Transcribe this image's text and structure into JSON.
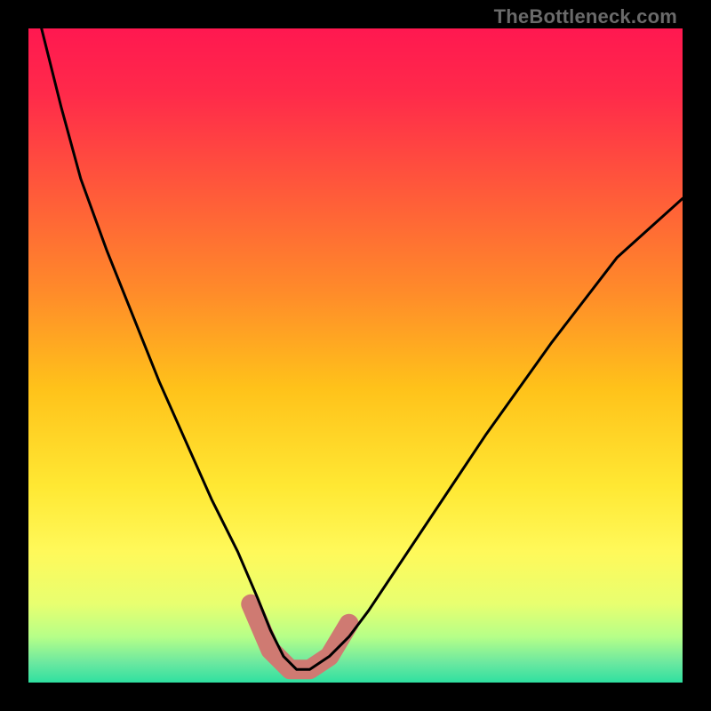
{
  "watermark": {
    "text": "TheBottleneck.com"
  },
  "colors": {
    "frame": "#000000",
    "curve_stroke": "#000000",
    "overlay_stroke": "#cf7a72",
    "gradient_stops": [
      {
        "offset": 0.0,
        "color": "#ff1850"
      },
      {
        "offset": 0.1,
        "color": "#ff2a4a"
      },
      {
        "offset": 0.25,
        "color": "#ff5a3a"
      },
      {
        "offset": 0.4,
        "color": "#ff8a2a"
      },
      {
        "offset": 0.55,
        "color": "#ffc21a"
      },
      {
        "offset": 0.7,
        "color": "#ffe833"
      },
      {
        "offset": 0.8,
        "color": "#fff95a"
      },
      {
        "offset": 0.88,
        "color": "#e8ff70"
      },
      {
        "offset": 0.93,
        "color": "#b6ff88"
      },
      {
        "offset": 0.97,
        "color": "#6be8a0"
      },
      {
        "offset": 1.0,
        "color": "#2fe0a0"
      }
    ]
  },
  "chart_data": {
    "type": "line",
    "title": "",
    "xlabel": "",
    "ylabel": "",
    "xlim": [
      0,
      100
    ],
    "ylim": [
      0,
      100
    ],
    "series": [
      {
        "name": "bottleneck-curve",
        "x": [
          2,
          5,
          8,
          12,
          16,
          20,
          24,
          28,
          32,
          35,
          37,
          39,
          41,
          43,
          46,
          49,
          52,
          56,
          62,
          70,
          80,
          90,
          100
        ],
        "y": [
          100,
          88,
          77,
          66,
          56,
          46,
          37,
          28,
          20,
          13,
          8,
          4,
          2,
          2,
          4,
          7,
          11,
          17,
          26,
          38,
          52,
          65,
          74
        ]
      }
    ],
    "overlay": {
      "name": "highlight-band",
      "x": [
        34,
        37,
        40,
        43,
        46,
        49
      ],
      "y": [
        12,
        5,
        2,
        2,
        4,
        9
      ]
    }
  }
}
